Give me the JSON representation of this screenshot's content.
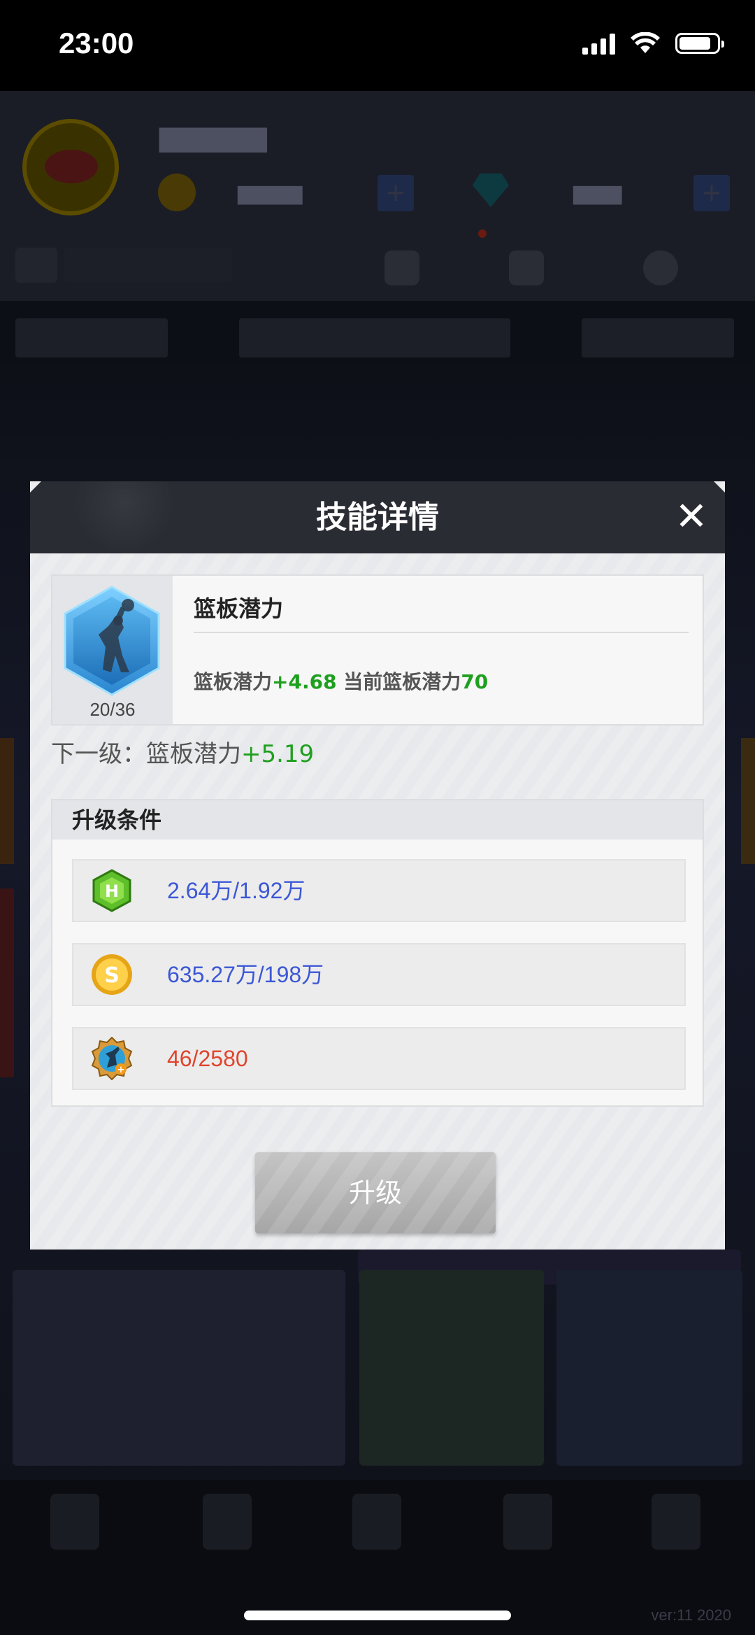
{
  "status_bar": {
    "time": "23:00"
  },
  "modal": {
    "title": "技能详情",
    "close_symbol": "✕",
    "skill": {
      "name": "篮板潜力",
      "level": "20/36",
      "desc_prefix": "篮板潜力",
      "desc_bonus": "+4.68",
      "desc_current_label": " 当前篮板潜力",
      "desc_current_value": "70",
      "icon": "player-rebound-hexagon-icon"
    },
    "next_level": {
      "label": "下一级：",
      "stat": "篮板潜力",
      "bonus": "+5.19"
    },
    "conditions": {
      "title": "升级条件",
      "items": [
        {
          "icon": "h-badge-icon",
          "value": "2.64万/1.92万",
          "color": "#3b57d6"
        },
        {
          "icon": "gold-coin-icon",
          "value": "635.27万/198万",
          "color": "#3b57d6"
        },
        {
          "icon": "skill-book-medal-icon",
          "value": "46/2580",
          "color": "#e0442c"
        }
      ]
    },
    "upgrade_button": "升级"
  },
  "footer": {
    "version": "ver:11  2020"
  },
  "colors": {
    "accent_green": "#1ea01e",
    "accent_blue": "#3b57d6",
    "accent_red": "#e0442c"
  }
}
